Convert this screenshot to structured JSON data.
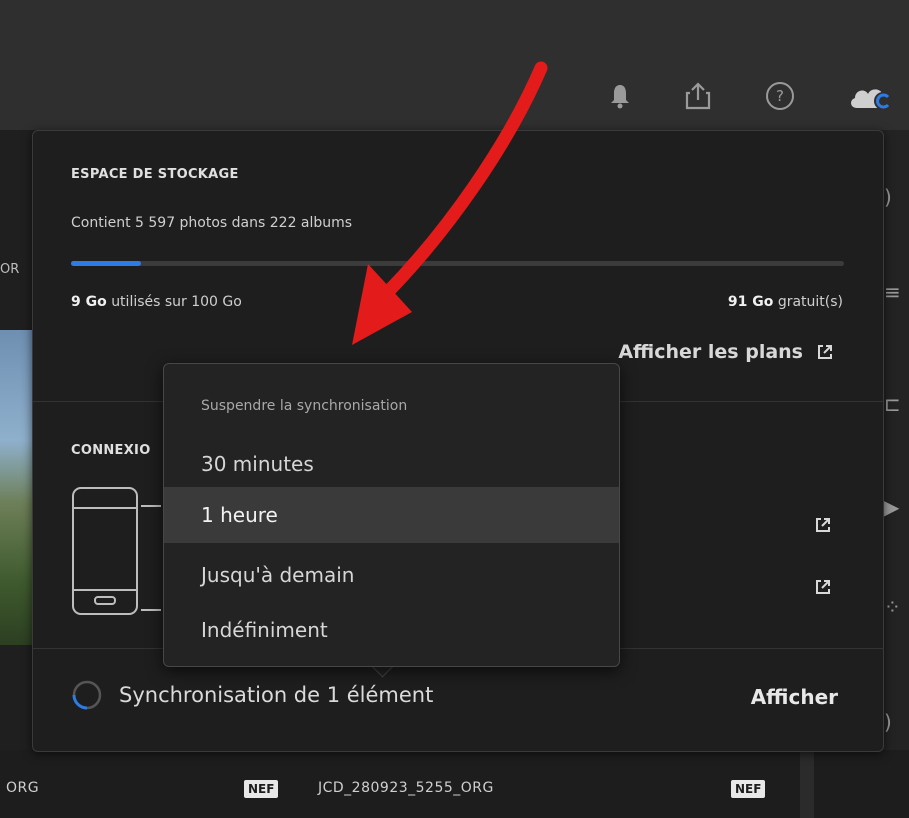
{
  "colors": {
    "accent": "#2d7be5",
    "panel_bg": "#1e1e1e",
    "menu_selected_bg": "#3a3a3a",
    "annotation_arrow": "#e31b1b"
  },
  "topbar": {
    "icons": [
      "bell-icon",
      "share-icon",
      "help-icon",
      "cloud-sync-icon"
    ]
  },
  "background": {
    "left_label": "OR",
    "thumb_labels": [
      "ORG",
      "JCD_280923_5255_ORG"
    ],
    "badges": [
      "NEF",
      "NEF"
    ],
    "dots": [
      "..",
      ".."
    ]
  },
  "storage": {
    "title": "ESPACE DE STOCKAGE",
    "description": "Contient 5 597 photos dans 222 albums",
    "used_amount": "9 Go",
    "used_suffix": "utilisés sur 100 Go",
    "free_amount": "91 Go",
    "free_suffix": "gratuit(s)",
    "usage_fraction": 0.09,
    "plans_link": "Afficher les plans"
  },
  "connections": {
    "title": "CONNEXIO"
  },
  "sync": {
    "status": "Synchronisation de 1 élément",
    "action": "Afficher"
  },
  "pause_menu": {
    "header": "Suspendre la synchronisation",
    "items": [
      {
        "label": "30 minutes",
        "selected": false
      },
      {
        "label": "1 heure",
        "selected": true
      },
      {
        "label": "Jusqu'à demain",
        "selected": false
      },
      {
        "label": "Indéfiniment",
        "selected": false
      }
    ]
  }
}
